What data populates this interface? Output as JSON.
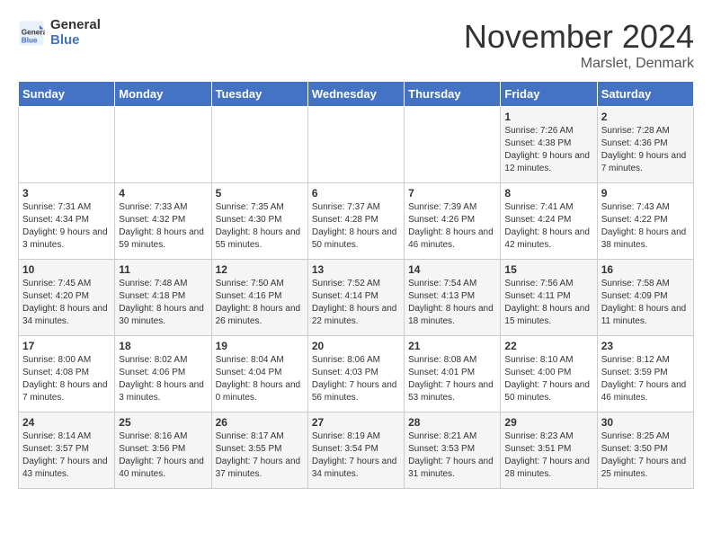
{
  "header": {
    "logo_line1": "General",
    "logo_line2": "Blue",
    "month": "November 2024",
    "location": "Marslet, Denmark"
  },
  "days_of_week": [
    "Sunday",
    "Monday",
    "Tuesday",
    "Wednesday",
    "Thursday",
    "Friday",
    "Saturday"
  ],
  "weeks": [
    [
      {
        "day": "",
        "info": ""
      },
      {
        "day": "",
        "info": ""
      },
      {
        "day": "",
        "info": ""
      },
      {
        "day": "",
        "info": ""
      },
      {
        "day": "",
        "info": ""
      },
      {
        "day": "1",
        "info": "Sunrise: 7:26 AM\nSunset: 4:38 PM\nDaylight: 9 hours and 12 minutes."
      },
      {
        "day": "2",
        "info": "Sunrise: 7:28 AM\nSunset: 4:36 PM\nDaylight: 9 hours and 7 minutes."
      }
    ],
    [
      {
        "day": "3",
        "info": "Sunrise: 7:31 AM\nSunset: 4:34 PM\nDaylight: 9 hours and 3 minutes."
      },
      {
        "day": "4",
        "info": "Sunrise: 7:33 AM\nSunset: 4:32 PM\nDaylight: 8 hours and 59 minutes."
      },
      {
        "day": "5",
        "info": "Sunrise: 7:35 AM\nSunset: 4:30 PM\nDaylight: 8 hours and 55 minutes."
      },
      {
        "day": "6",
        "info": "Sunrise: 7:37 AM\nSunset: 4:28 PM\nDaylight: 8 hours and 50 minutes."
      },
      {
        "day": "7",
        "info": "Sunrise: 7:39 AM\nSunset: 4:26 PM\nDaylight: 8 hours and 46 minutes."
      },
      {
        "day": "8",
        "info": "Sunrise: 7:41 AM\nSunset: 4:24 PM\nDaylight: 8 hours and 42 minutes."
      },
      {
        "day": "9",
        "info": "Sunrise: 7:43 AM\nSunset: 4:22 PM\nDaylight: 8 hours and 38 minutes."
      }
    ],
    [
      {
        "day": "10",
        "info": "Sunrise: 7:45 AM\nSunset: 4:20 PM\nDaylight: 8 hours and 34 minutes."
      },
      {
        "day": "11",
        "info": "Sunrise: 7:48 AM\nSunset: 4:18 PM\nDaylight: 8 hours and 30 minutes."
      },
      {
        "day": "12",
        "info": "Sunrise: 7:50 AM\nSunset: 4:16 PM\nDaylight: 8 hours and 26 minutes."
      },
      {
        "day": "13",
        "info": "Sunrise: 7:52 AM\nSunset: 4:14 PM\nDaylight: 8 hours and 22 minutes."
      },
      {
        "day": "14",
        "info": "Sunrise: 7:54 AM\nSunset: 4:13 PM\nDaylight: 8 hours and 18 minutes."
      },
      {
        "day": "15",
        "info": "Sunrise: 7:56 AM\nSunset: 4:11 PM\nDaylight: 8 hours and 15 minutes."
      },
      {
        "day": "16",
        "info": "Sunrise: 7:58 AM\nSunset: 4:09 PM\nDaylight: 8 hours and 11 minutes."
      }
    ],
    [
      {
        "day": "17",
        "info": "Sunrise: 8:00 AM\nSunset: 4:08 PM\nDaylight: 8 hours and 7 minutes."
      },
      {
        "day": "18",
        "info": "Sunrise: 8:02 AM\nSunset: 4:06 PM\nDaylight: 8 hours and 3 minutes."
      },
      {
        "day": "19",
        "info": "Sunrise: 8:04 AM\nSunset: 4:04 PM\nDaylight: 8 hours and 0 minutes."
      },
      {
        "day": "20",
        "info": "Sunrise: 8:06 AM\nSunset: 4:03 PM\nDaylight: 7 hours and 56 minutes."
      },
      {
        "day": "21",
        "info": "Sunrise: 8:08 AM\nSunset: 4:01 PM\nDaylight: 7 hours and 53 minutes."
      },
      {
        "day": "22",
        "info": "Sunrise: 8:10 AM\nSunset: 4:00 PM\nDaylight: 7 hours and 50 minutes."
      },
      {
        "day": "23",
        "info": "Sunrise: 8:12 AM\nSunset: 3:59 PM\nDaylight: 7 hours and 46 minutes."
      }
    ],
    [
      {
        "day": "24",
        "info": "Sunrise: 8:14 AM\nSunset: 3:57 PM\nDaylight: 7 hours and 43 minutes."
      },
      {
        "day": "25",
        "info": "Sunrise: 8:16 AM\nSunset: 3:56 PM\nDaylight: 7 hours and 40 minutes."
      },
      {
        "day": "26",
        "info": "Sunrise: 8:17 AM\nSunset: 3:55 PM\nDaylight: 7 hours and 37 minutes."
      },
      {
        "day": "27",
        "info": "Sunrise: 8:19 AM\nSunset: 3:54 PM\nDaylight: 7 hours and 34 minutes."
      },
      {
        "day": "28",
        "info": "Sunrise: 8:21 AM\nSunset: 3:53 PM\nDaylight: 7 hours and 31 minutes."
      },
      {
        "day": "29",
        "info": "Sunrise: 8:23 AM\nSunset: 3:51 PM\nDaylight: 7 hours and 28 minutes."
      },
      {
        "day": "30",
        "info": "Sunrise: 8:25 AM\nSunset: 3:50 PM\nDaylight: 7 hours and 25 minutes."
      }
    ]
  ]
}
